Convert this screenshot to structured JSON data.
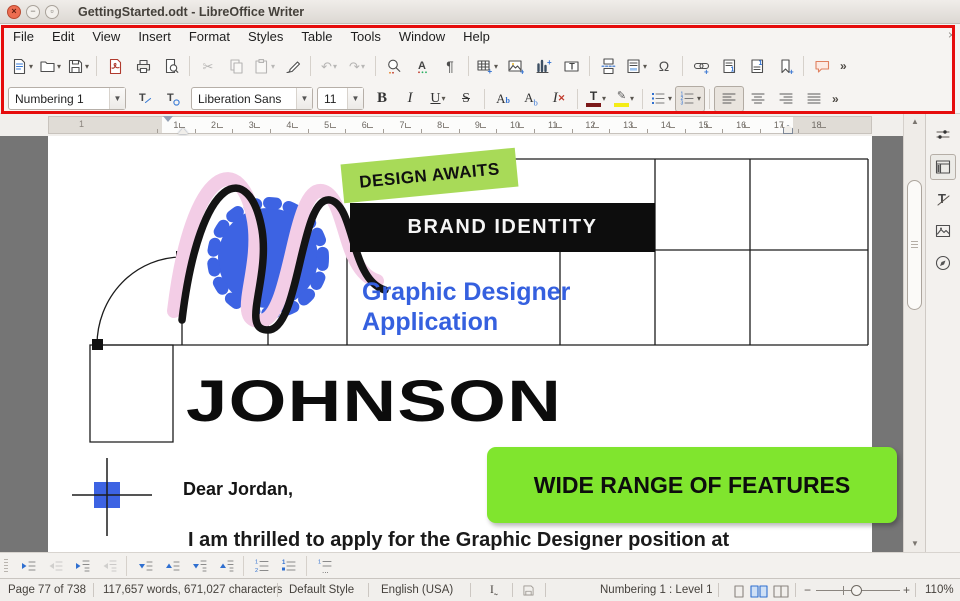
{
  "window": {
    "title": "GettingStarted.odt - LibreOffice Writer",
    "close_glyph": "×",
    "minimize_glyph": "−",
    "maximize_glyph": "▫"
  },
  "menu": {
    "items": [
      "File",
      "Edit",
      "View",
      "Insert",
      "Format",
      "Styles",
      "Table",
      "Tools",
      "Window",
      "Help"
    ],
    "close_glyph": "×"
  },
  "standard_toolbar": {
    "buttons": [
      "new-document",
      "open",
      "save",
      "export-pdf",
      "print",
      "print-preview",
      "cut",
      "copy",
      "paste",
      "clone-formatting",
      "undo",
      "redo",
      "find-and-replace",
      "spelling",
      "formatting-marks",
      "insert-table",
      "insert-image",
      "insert-chart",
      "insert-text-box",
      "insert-page-break",
      "insert-field",
      "insert-special-character",
      "insert-hyperlink",
      "insert-footnote",
      "insert-endnote",
      "insert-bookmark",
      "insert-comment"
    ],
    "disabled": [
      "cut",
      "copy",
      "paste",
      "undo",
      "redo"
    ],
    "overflow": "»",
    "omega_glyph": "Ω",
    "pilcrow_glyph": "¶",
    "cut_glyph": "✂",
    "undo_glyph": "↶",
    "redo_glyph": "↷"
  },
  "formatting_toolbar": {
    "paragraph_style": "Numbering 1",
    "font_name": "Liberation Sans",
    "font_size": "11",
    "bold_glyph": "B",
    "italic_glyph": "I",
    "underline_glyph": "U",
    "strikethrough_glyph": "S",
    "font_color_glyph": "T",
    "highlight_glyph": "✎",
    "clear_glyph": "I",
    "active_buttons": [
      "ordered-list",
      "align-left"
    ],
    "overflow": "»"
  },
  "ruler": {
    "margin_number": "1",
    "numbers": [
      "1",
      "2",
      "3",
      "4",
      "5",
      "6",
      "7",
      "8",
      "9",
      "10",
      "11",
      "12",
      "13",
      "14",
      "15",
      "16",
      "17",
      "18"
    ]
  },
  "document": {
    "label_design_awaits": "DESIGN AWAITS",
    "label_brand_identity": "BRAND IDENTITY",
    "subtitle_line1": "Graphic Designer",
    "subtitle_line2": "Application",
    "headline": "JOHNSON",
    "salutation": "Dear Jordan,",
    "body_line": "I am thrilled to apply for the Graphic Designer position at",
    "banner_label": "WIDE RANGE OF FEATURES"
  },
  "sidebar": {
    "tabs": [
      "sidebar-settings",
      "properties",
      "styles",
      "gallery",
      "navigator"
    ],
    "active": "properties"
  },
  "list_toolbar": {
    "buttons": [
      "demote",
      "promote",
      "demote-with-subpoints",
      "promote-with-subpoints",
      "move-down",
      "move-up",
      "move-down-with-subpoints",
      "move-up-with-subpoints",
      "insert-unnumbered-entry",
      "restart-numbering",
      "bullets-and-numbering"
    ]
  },
  "status_bar": {
    "page": "Page 77 of 738",
    "word_count": "117,657 words, 671,027 characters",
    "paragraph_style": "Default Style",
    "language": "English (USA)",
    "outline": "Numbering 1 : Level 1",
    "zoom_level": "110%",
    "zoom_minus": "−",
    "zoom_plus": "+"
  },
  "colors": {
    "annotation_red": "#e60c0c",
    "banner_green": "#80e52e",
    "label_green": "#a8da58",
    "brand_blue": "#3d63e3",
    "text_blue": "#3560df",
    "squiggle_pink": "#f3cde6"
  }
}
